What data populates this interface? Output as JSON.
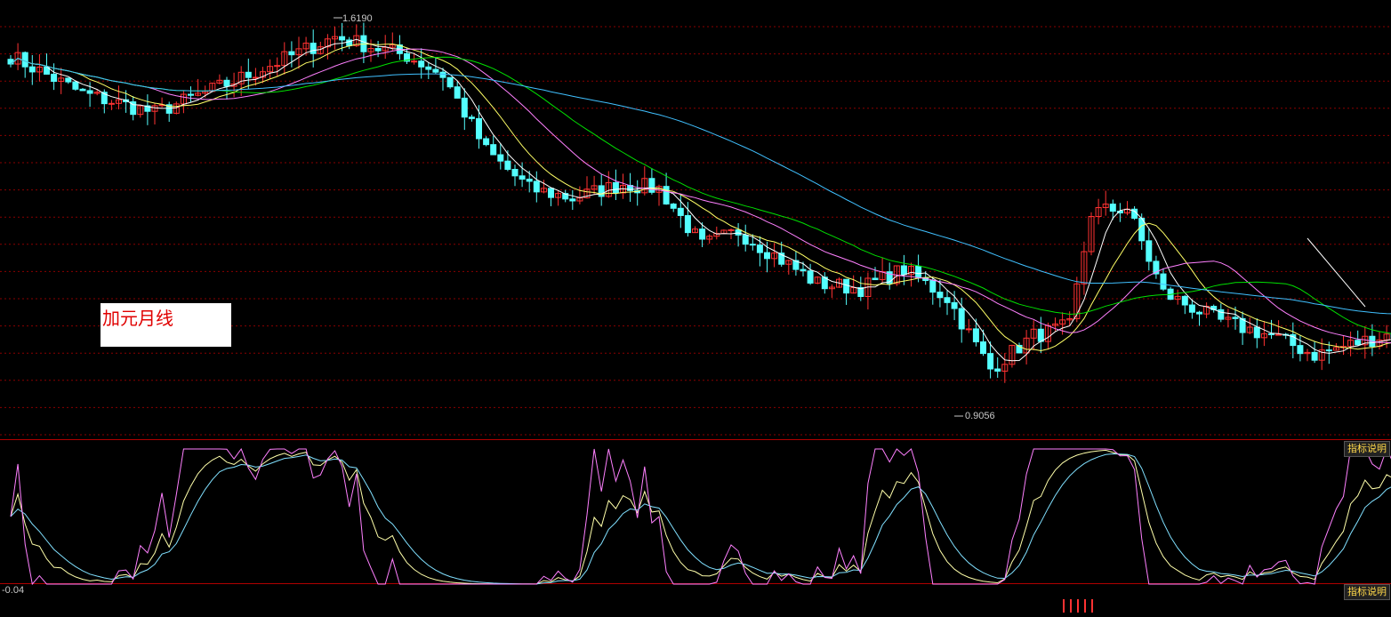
{
  "colors": {
    "background": "#000000",
    "grid": "#8a0000",
    "panel_border": "#b00000",
    "up_candle": "#ff3232",
    "down_candle": "#54ffff",
    "ma5": "#ffffff",
    "ma10": "#ffff66",
    "ma20": "#ff80ff",
    "ma30": "#00e000",
    "ma60": "#40c0ff",
    "kdj_k": "#ffffaa",
    "kdj_d": "#80e0ff",
    "kdj_j": "#ff80ff"
  },
  "callout": {
    "text": "加元月线"
  },
  "price_panel": {
    "high_label": "1.6190",
    "low_label": "0.9056"
  },
  "indicator_panel": {
    "explain_button": "指标说明",
    "axis_value": "-0.04"
  },
  "volume_panel": {
    "explain_button": "指标说明"
  },
  "chart_data": [
    {
      "type": "candlestick",
      "period": "monthly",
      "ylim": [
        0.83,
        1.66
      ],
      "high": 1.619,
      "low": 0.9056,
      "grid": true,
      "close_waypoints": [
        [
          0,
          1.58
        ],
        [
          10,
          1.5
        ],
        [
          20,
          1.46
        ],
        [
          30,
          1.52
        ],
        [
          45,
          1.62
        ],
        [
          55,
          1.58
        ],
        [
          60,
          1.54
        ],
        [
          66,
          1.38
        ],
        [
          72,
          1.3
        ],
        [
          78,
          1.28
        ],
        [
          85,
          1.31
        ],
        [
          90,
          1.3
        ],
        [
          96,
          1.18
        ],
        [
          101,
          1.21
        ],
        [
          106,
          1.16
        ],
        [
          112,
          1.1
        ],
        [
          118,
          1.09
        ],
        [
          124,
          1.13
        ],
        [
          130,
          1.07
        ],
        [
          136,
          0.92
        ],
        [
          142,
          0.99
        ],
        [
          147,
          1.01
        ],
        [
          150,
          1.25
        ],
        [
          155,
          1.26
        ],
        [
          160,
          1.08
        ],
        [
          168,
          1.02
        ],
        [
          175,
          0.99
        ],
        [
          181,
          0.95
        ],
        [
          188,
          0.98
        ],
        [
          193,
          1.0
        ]
      ],
      "moving_averages": [
        {
          "period": 5,
          "color_key": "ma5"
        },
        {
          "period": 10,
          "color_key": "ma10"
        },
        {
          "period": 20,
          "color_key": "ma20"
        },
        {
          "period": 30,
          "color_key": "ma30"
        },
        {
          "period": 60,
          "color_key": "ma60"
        }
      ]
    },
    {
      "type": "line",
      "indicator": "KDJ",
      "ylim": [
        -0.04,
        1.0
      ],
      "series": [
        {
          "color_key": "kdj_k"
        },
        {
          "color_key": "kdj_d"
        },
        {
          "color_key": "kdj_j"
        }
      ]
    }
  ]
}
